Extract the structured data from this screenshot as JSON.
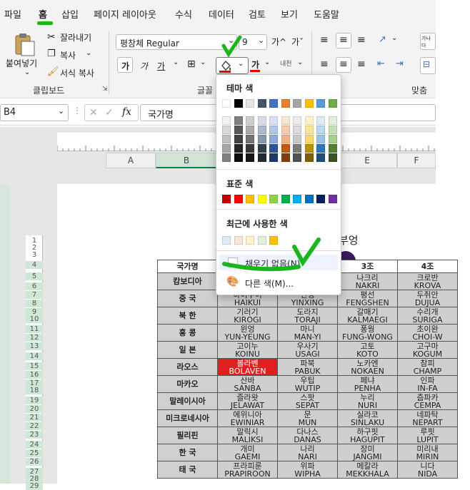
{
  "menu": {
    "items": [
      "파일",
      "홈",
      "삽입",
      "페이지 레이아웃",
      "수식",
      "데이터",
      "검토",
      "보기",
      "도움말"
    ]
  },
  "ribbon": {
    "paste_label": "붙여넣기",
    "cut_label": "잘라내기",
    "copy_label": "복사",
    "format_painter_label": "서식 복사",
    "clipboard_group": "클립보드",
    "font_group_label": "글꼴",
    "align_group_label": "맞춤",
    "font_name": "평창체 Regular",
    "font_size": "9",
    "bold_label": "가",
    "italic_label": "가",
    "underline_label": "가",
    "font_color_label": "가",
    "phonetic_label": "내천",
    "grow_font": "가^",
    "shrink_font": "가ˇ"
  },
  "formula_bar": {
    "name_box": "B4",
    "fx": "fx",
    "content": "국가명"
  },
  "columns": [
    "A",
    "B",
    "C",
    "D",
    "E",
    "F"
  ],
  "rows": [
    "1",
    "2",
    "3",
    "4",
    "5",
    "6",
    "7",
    "8",
    "9",
    "10",
    "11",
    "12",
    "13",
    "14",
    "15",
    "16",
    "17",
    "18",
    "19",
    "20",
    "21",
    "22",
    "23",
    "24",
    "25",
    "26",
    "27",
    "28",
    "29"
  ],
  "title_fragment": "부엉",
  "table": {
    "headers": [
      "국가명",
      "",
      "",
      "3조",
      "4조"
    ],
    "rows": [
      {
        "country": "캄보디아",
        "cells": [
          [
            "",
            ""
          ],
          [
            "",
            ""
          ],
          [
            "나크리",
            "NAKRI"
          ],
          [
            "크로반",
            "KROVA"
          ]
        ]
      },
      {
        "country": "중 국",
        "cells": [
          [
            "하이쿠이",
            "HAIKUI"
          ],
          [
            "인싱",
            "YINXING"
          ],
          [
            "평선",
            "FENGSHEN"
          ],
          [
            "두쥐안",
            "DUJUA"
          ]
        ]
      },
      {
        "country": "북 한",
        "cells": [
          [
            "기러기",
            "KIROGI"
          ],
          [
            "도라지",
            "TORAJI"
          ],
          [
            "갈매기",
            "KALMAEGI"
          ],
          [
            "수리개",
            "SURIGA"
          ]
        ]
      },
      {
        "country": "홍 콩",
        "cells": [
          [
            "윈엉",
            "YUN-YEUNG"
          ],
          [
            "마니",
            "MAN-YI"
          ],
          [
            "퐁웡",
            "FUNG-WONG"
          ],
          [
            "초이완",
            "CHOI-W"
          ]
        ]
      },
      {
        "country": "일 본",
        "cells": [
          [
            "고이누",
            "KOINU"
          ],
          [
            "우사기",
            "USAGI"
          ],
          [
            "고토",
            "KOTO"
          ],
          [
            "고구마",
            "KOGUM"
          ]
        ]
      },
      {
        "country": "라오스",
        "cells": [
          [
            "볼라벤",
            "BOLAVEN",
            "red"
          ],
          [
            "파북",
            "PABUK"
          ],
          [
            "노카엔",
            "NOKAEN"
          ],
          [
            "참피",
            "CHAMP"
          ]
        ]
      },
      {
        "country": "마카오",
        "cells": [
          [
            "산바",
            "SANBA"
          ],
          [
            "우팁",
            "WUTIP"
          ],
          [
            "페냐",
            "PENHA"
          ],
          [
            "인파",
            "IN-FA"
          ]
        ]
      },
      {
        "country": "말레이시아",
        "cells": [
          [
            "즐라왓",
            "JELAWAT"
          ],
          [
            "스팟",
            "SEPAT"
          ],
          [
            "누리",
            "NURI"
          ],
          [
            "츰파카",
            "CEMPA"
          ]
        ]
      },
      {
        "country": "미크로네시아",
        "cells": [
          [
            "에위니아",
            "EWINIAR"
          ],
          [
            "문",
            "MUN"
          ],
          [
            "실라코",
            "SINLAKU"
          ],
          [
            "네파탁",
            "NEPART"
          ]
        ]
      },
      {
        "country": "필리핀",
        "cells": [
          [
            "말릭시",
            "MALIKSI"
          ],
          [
            "다나스",
            "DANAS"
          ],
          [
            "하구핏",
            "HAGUPIT"
          ],
          [
            "루핏",
            "LUPIT"
          ]
        ]
      },
      {
        "country": "한 국",
        "cells": [
          [
            "개미",
            "GAEMI"
          ],
          [
            "나리",
            "NARI"
          ],
          [
            "장미",
            "JANGMI"
          ],
          [
            "미리내",
            "MIRIN"
          ]
        ]
      },
      {
        "country": "태 국",
        "cells": [
          [
            "프라피룬",
            "PRAPIROON"
          ],
          [
            "위파",
            "WIPHA"
          ],
          [
            "메칼라",
            "MEKKHALA"
          ],
          [
            "니다",
            "NIDA"
          ]
        ]
      }
    ]
  },
  "color_menu": {
    "theme_title": "테마 색",
    "standard_title": "표준 색",
    "recent_title": "최근에 사용한 색",
    "no_fill": "채우기 없음(N)",
    "more_colors": "다른 색(M)...",
    "theme_top": [
      "#ffffff",
      "#000000",
      "#e7e6e6",
      "#44546a",
      "#4472c4",
      "#ed7d31",
      "#a5a5a5",
      "#ffc000",
      "#5b9bd5",
      "#70ad47"
    ],
    "theme_shades": [
      [
        "#f2f2f2",
        "#d9d9d9",
        "#bfbfbf",
        "#a6a6a6",
        "#808080"
      ],
      [
        "#808080",
        "#595959",
        "#404040",
        "#262626",
        "#0d0d0d"
      ],
      [
        "#d0cece",
        "#aeaaaa",
        "#757171",
        "#3a3838",
        "#171616"
      ],
      [
        "#d6dce4",
        "#adb9ca",
        "#8497b0",
        "#333f4f",
        "#222a35"
      ],
      [
        "#d9e2f3",
        "#b4c6e7",
        "#8eaadb",
        "#2f5496",
        "#1f3864"
      ],
      [
        "#fbe5d5",
        "#f7cbac",
        "#f4b183",
        "#c55a11",
        "#833c0b"
      ],
      [
        "#ededed",
        "#dbdbdb",
        "#c9c9c9",
        "#7b7b7b",
        "#525252"
      ],
      [
        "#fff2cc",
        "#ffe598",
        "#ffd965",
        "#bf9000",
        "#7f6000"
      ],
      [
        "#deebf6",
        "#bdd7ee",
        "#9cc3e5",
        "#2e75b5",
        "#1f4e79"
      ],
      [
        "#e2efd9",
        "#c5e0b3",
        "#a8d08d",
        "#538135",
        "#375623"
      ]
    ],
    "standard": [
      "#c00000",
      "#ff0000",
      "#ffc000",
      "#ffff00",
      "#92d050",
      "#00b050",
      "#00b0f0",
      "#0070c0",
      "#002060",
      "#7030a0"
    ],
    "recent": [
      "#deebf6",
      "#fbe5d5",
      "#fff2cc",
      "#e2efd9",
      "#ffc000"
    ]
  },
  "colors": {
    "accent_green": "#1db51d",
    "excel_green": "#107c41",
    "highlight_red": "#e02020"
  }
}
